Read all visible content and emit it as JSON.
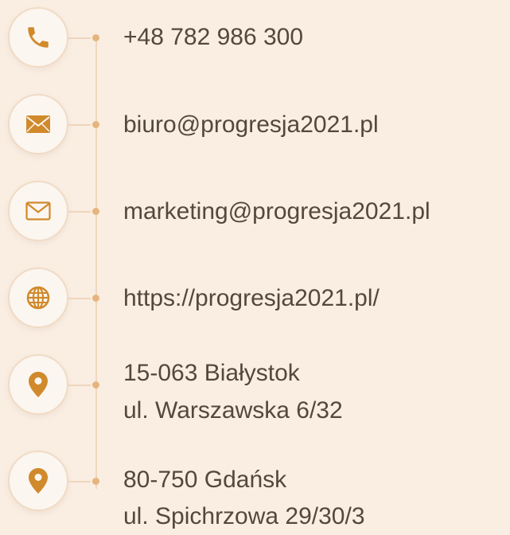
{
  "accent_color": "#d08a2c",
  "line_color": "#f0d7bd",
  "background_color": "#faeee3",
  "contacts": [
    {
      "icon": "phone-icon",
      "lines": [
        "+48 782 986 300"
      ]
    },
    {
      "icon": "envelope-filled-icon",
      "lines": [
        "biuro@progresja2021.pl"
      ]
    },
    {
      "icon": "envelope-outline-icon",
      "lines": [
        "marketing@progresja2021.pl"
      ]
    },
    {
      "icon": "globe-icon",
      "lines": [
        "https://progresja2021.pl/"
      ]
    },
    {
      "icon": "location-pin-icon",
      "lines": [
        "15-063 Białystok",
        "ul. Warszawska 6/32"
      ]
    },
    {
      "icon": "location-pin-icon",
      "lines": [
        "80-750 Gdańsk",
        "ul. Spichrzowa 29/30/3"
      ]
    }
  ]
}
